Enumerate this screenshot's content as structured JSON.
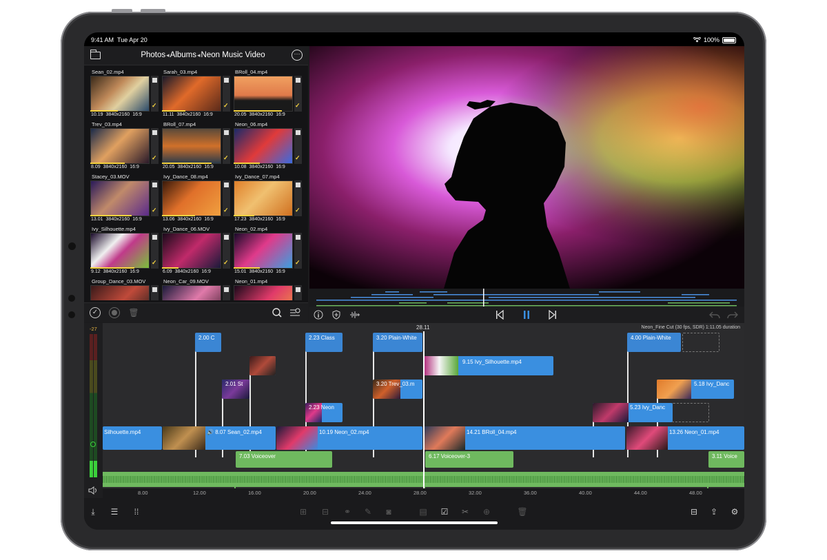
{
  "status": {
    "time": "9:41 AM",
    "date": "Tue Apr 20",
    "battery": "100%"
  },
  "browser": {
    "breadcrumb": [
      "Photos",
      "Albums",
      "Neon Music Video"
    ],
    "clips": [
      {
        "name": "Sean_02.mp4",
        "duration": "10.19",
        "res": "3840x2160",
        "aspect": "16:9"
      },
      {
        "name": "Sarah_03.mp4",
        "duration": "11.11",
        "res": "3840x2160",
        "aspect": "16:9"
      },
      {
        "name": "BRoll_04.mp4",
        "duration": "20.05",
        "res": "3840x2160",
        "aspect": "16:9"
      },
      {
        "name": "Trev_03.mp4",
        "duration": "8.09",
        "res": "3840x2160",
        "aspect": "16:9"
      },
      {
        "name": "BRoll_07.mp4",
        "duration": "20.05",
        "res": "3840x2160",
        "aspect": "16:9"
      },
      {
        "name": "Neon_06.mp4",
        "duration": "10.08",
        "res": "3840x2160",
        "aspect": "16:9"
      },
      {
        "name": "Stacey_03.MOV",
        "duration": "13.01",
        "res": "3840x2160",
        "aspect": "16:9"
      },
      {
        "name": "Ivy_Dance_08.mp4",
        "duration": "13.06",
        "res": "3840x2160",
        "aspect": "16:9"
      },
      {
        "name": "Ivy_Dance_07.mp4",
        "duration": "17.23",
        "res": "3840x2160",
        "aspect": "16:9"
      },
      {
        "name": "Ivy_Silhouette.mp4",
        "duration": "9.12",
        "res": "3840x2160",
        "aspect": "16:9"
      },
      {
        "name": "Ivy_Dance_06.MOV",
        "duration": "6.09",
        "res": "3840x2160",
        "aspect": "16:9"
      },
      {
        "name": "Neon_02.mp4",
        "duration": "15.01",
        "res": "3840x2160",
        "aspect": "16:9"
      },
      {
        "name": "Group_Dance_03.MOV",
        "duration": "",
        "res": "",
        "aspect": ""
      },
      {
        "name": "Neon_Car_09.MOV",
        "duration": "",
        "res": "",
        "aspect": ""
      },
      {
        "name": "Neon_01.mp4",
        "duration": "",
        "res": "",
        "aspect": ""
      }
    ]
  },
  "timeline": {
    "playhead": "28.11",
    "project_info": "Neon_Fine Cut (30 fps, SDR)  1:11.05 duration",
    "meter_level": "-27",
    "titles": [
      {
        "text": "2.00  C"
      },
      {
        "text": "2.23  Class"
      },
      {
        "text": "3.20  Plain-White"
      },
      {
        "text": "4.00  Plain-White"
      }
    ],
    "connected": [
      {
        "text": "9.15  Ivy_Silhouette.mp4"
      },
      {
        "text": "2.01  St"
      },
      {
        "text": "3.20  Trev_03.m"
      },
      {
        "text": "5.18  Ivy_Danc"
      },
      {
        "text": "2.23  Neon"
      },
      {
        "text": "5.23  Ivy_Danc"
      }
    ],
    "primary": [
      {
        "text": "Silhouette.mp4"
      },
      {
        "text": "8.07  Sean_02.mp4"
      },
      {
        "text": "10.19  Neon_02.mp4"
      },
      {
        "text": "14.21  BRoll_04.mp4"
      },
      {
        "text": "13.26  Neon_01.mp4"
      }
    ],
    "audio": [
      {
        "text": "7.03  Voiceover"
      },
      {
        "text": "6.17  Voiceover-3"
      },
      {
        "text": "3.11  Voice"
      }
    ],
    "ruler": [
      "8.00",
      "12.00",
      "16.00",
      "20.00",
      "24.00",
      "28.00",
      "32.00",
      "36.00",
      "40.00",
      "44.00",
      "48.00"
    ]
  },
  "colors": {
    "clip_blue": "#3a8fe0",
    "audio_green": "#6fb95f",
    "accent_yellow": "#f5d33f"
  }
}
